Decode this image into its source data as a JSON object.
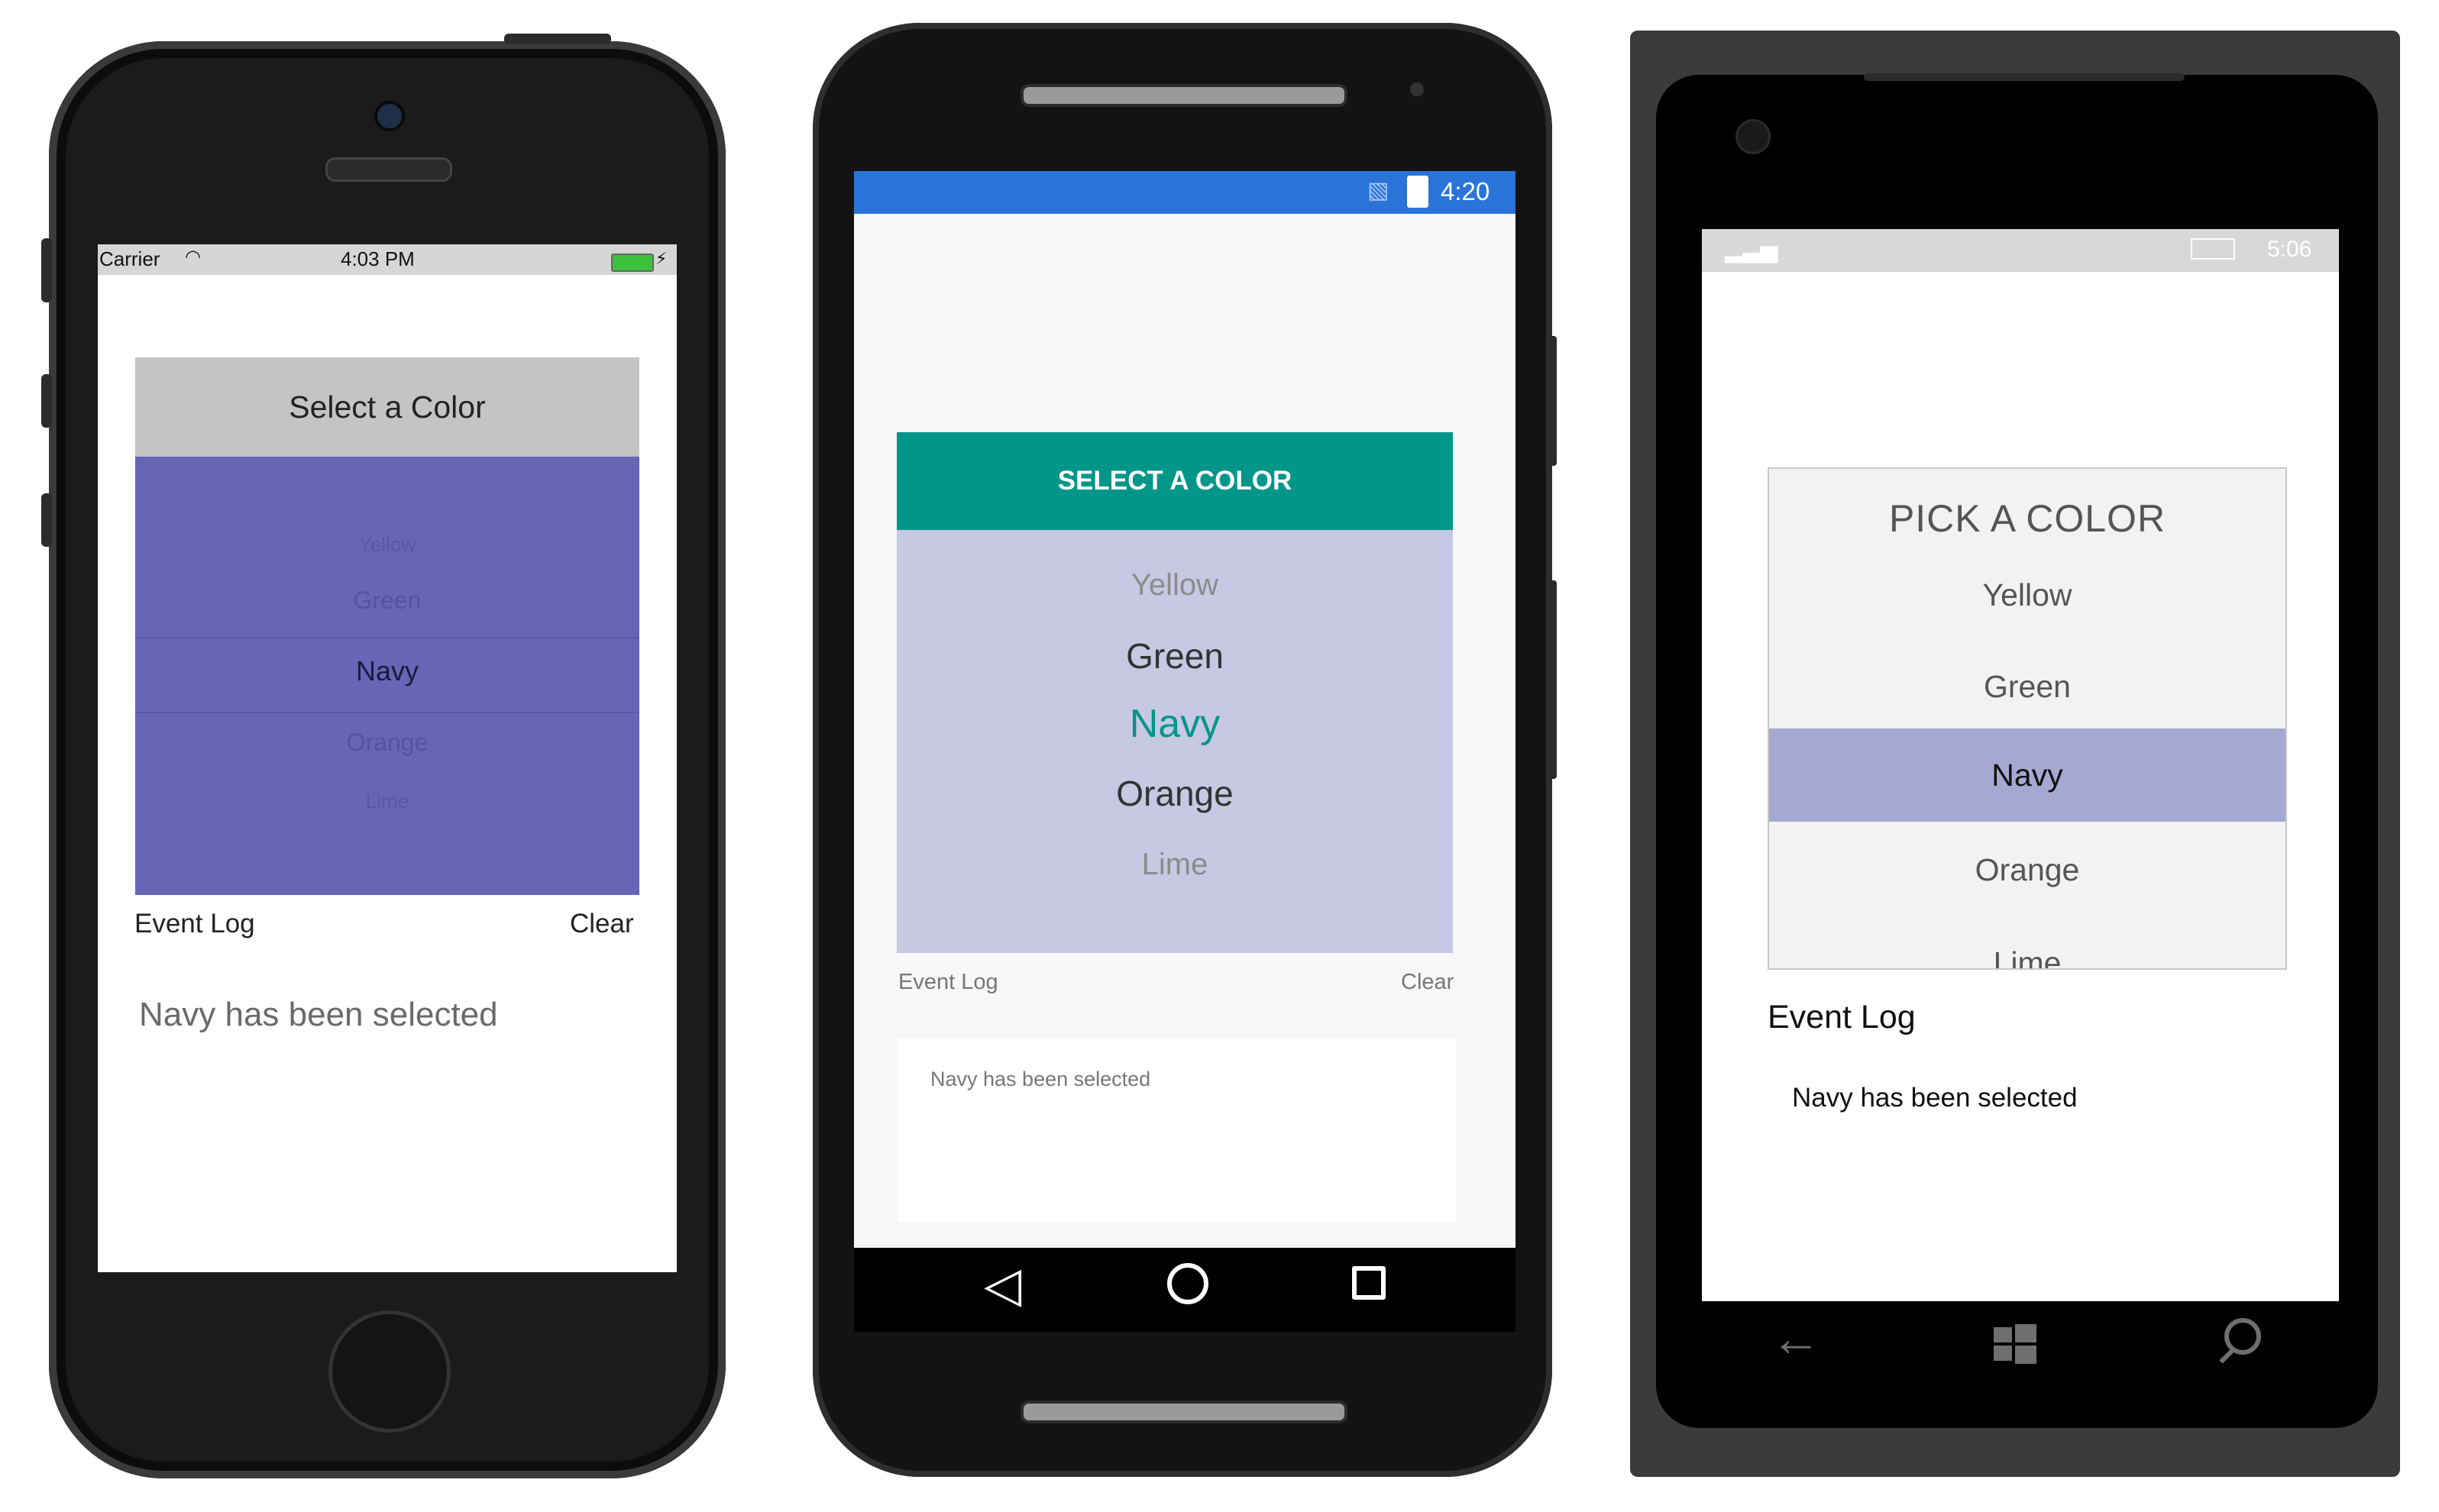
{
  "ios": {
    "status": {
      "carrier": "Carrier",
      "time": "4:03 PM"
    },
    "picker_title": "Select a Color",
    "items": [
      "Yellow",
      "Green",
      "Navy",
      "Orange",
      "Lime"
    ],
    "event_log_label": "Event Log",
    "clear_label": "Clear",
    "log_message": "Navy has been selected"
  },
  "android": {
    "status": {
      "time": "4:20"
    },
    "picker_title": "SELECT A COLOR",
    "items": [
      "Yellow",
      "Green",
      "Navy",
      "Orange",
      "Lime"
    ],
    "event_log_label": "Event Log",
    "clear_label": "Clear",
    "log_message": "Navy has been selected",
    "accent_color": "#00968a"
  },
  "windows": {
    "status": {
      "time": "5:06"
    },
    "picker_title": "PICK A COLOR",
    "items": [
      "Yellow",
      "Green",
      "Navy",
      "Orange",
      "Lime"
    ],
    "selected": "Navy",
    "event_log_label": "Event Log",
    "log_message": "Navy has been selected",
    "selection_color": "#a5a8d1"
  }
}
